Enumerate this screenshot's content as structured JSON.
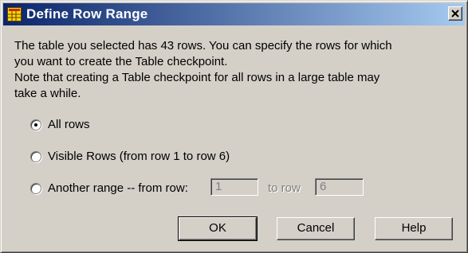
{
  "window": {
    "title": "Define Row Range",
    "close_glyph": "×"
  },
  "message": {
    "lines": [
      "The table you selected has 43  rows. You can specify the rows for which",
      "you want to create the Table checkpoint.",
      "Note that creating a Table checkpoint for all rows in a large table may",
      "take a while."
    ]
  },
  "options": {
    "all_rows": {
      "label": "All rows",
      "checked": true
    },
    "visible_rows": {
      "label": "Visible Rows (from row 1 to row 6)",
      "checked": false
    },
    "another_range": {
      "label": "Another range -- from row:",
      "checked": false,
      "from_value": "1",
      "to_label": "to row",
      "to_value": "6"
    }
  },
  "buttons": {
    "ok": "OK",
    "cancel": "Cancel",
    "help": "Help"
  },
  "colors": {
    "titlebar_start": "#0a246a",
    "titlebar_end": "#a6caf0",
    "dialog_face": "#d4d0c8"
  },
  "icons": {
    "app": "table-grid-icon",
    "close": "close-icon"
  }
}
